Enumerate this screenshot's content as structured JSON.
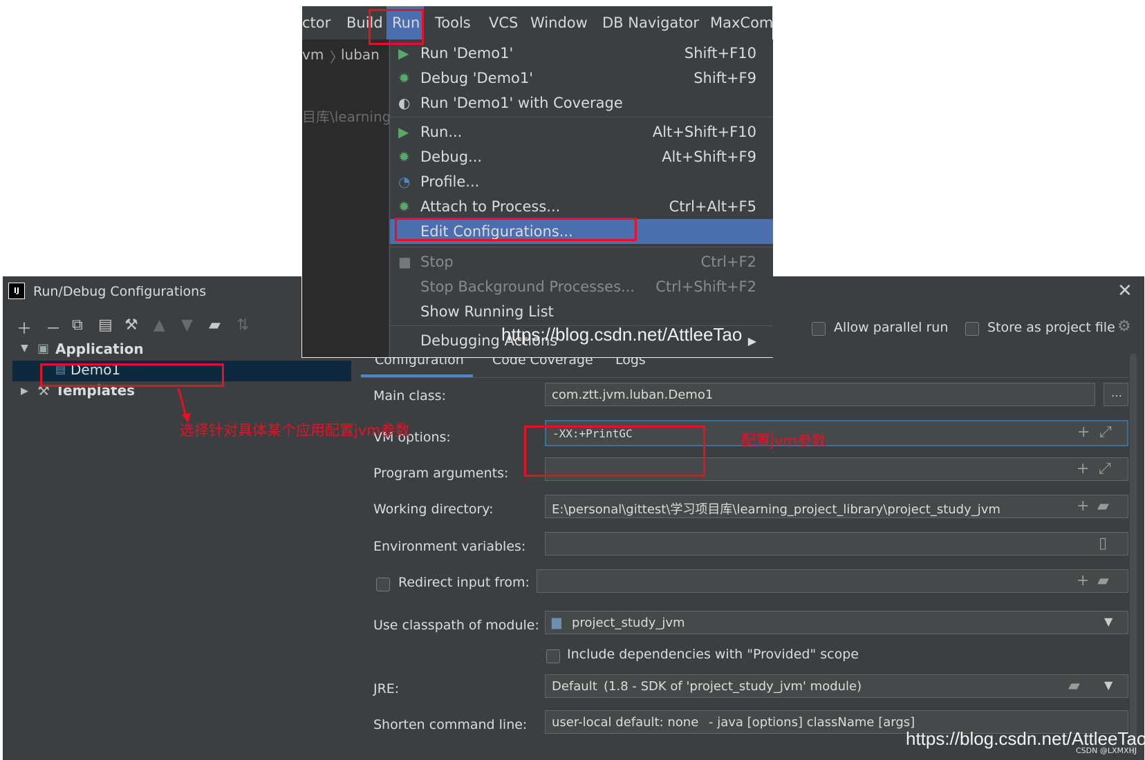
{
  "menubar": {
    "items": [
      "ctor",
      "Build",
      "Run",
      "Tools",
      "VCS",
      "Window",
      "DB Navigator",
      "MaxCom"
    ]
  },
  "editor_bg": {
    "breadcrumb_a": "vm",
    "breadcrumb_b": "luban",
    "path_fragment": "目库\\learning"
  },
  "run_menu": {
    "items": [
      {
        "label": "Run 'Demo1'",
        "shortcut": "Shift+F10",
        "icon": "play-icon"
      },
      {
        "label": "Debug 'Demo1'",
        "shortcut": "Shift+F9",
        "icon": "bug-icon"
      },
      {
        "label": "Run 'Demo1' with Coverage",
        "shortcut": "",
        "icon": "coverage-icon"
      },
      {
        "label": "Run...",
        "shortcut": "Alt+Shift+F10",
        "icon": "play-icon"
      },
      {
        "label": "Debug...",
        "shortcut": "Alt+Shift+F9",
        "icon": "bug-icon"
      },
      {
        "label": "Profile...",
        "shortcut": "",
        "icon": "gauge-icon"
      },
      {
        "label": "Attach to Process...",
        "shortcut": "Ctrl+Alt+F5",
        "icon": "attach-bug-icon"
      },
      {
        "label": "Edit Configurations...",
        "shortcut": "",
        "icon": ""
      },
      {
        "label": "Stop",
        "shortcut": "Ctrl+F2",
        "icon": "stop-icon"
      },
      {
        "label": "Stop Background Processes...",
        "shortcut": "Ctrl+Shift+F2",
        "icon": ""
      },
      {
        "label": "Show Running List",
        "shortcut": "",
        "icon": ""
      },
      {
        "label": "Debugging Actions",
        "shortcut": "",
        "icon": "submenu-arrow-icon"
      }
    ]
  },
  "dialog": {
    "title": "Run/Debug Configurations",
    "logo_text": "IJ",
    "close_glyph": "✕",
    "allow_parallel_run": "Allow parallel run",
    "store_as_project_file": "Store as project file",
    "tree": {
      "application": "Application",
      "demo1": "Demo1",
      "templates": "Templates"
    },
    "tabs": [
      "Configuration",
      "Code Coverage",
      "Logs"
    ],
    "fields": {
      "main_class_label": "Main class:",
      "main_class_value": "com.ztt.jvm.luban.Demo1",
      "vm_options_label": "VM options:",
      "vm_options_value": "-XX:+PrintGC",
      "program_arguments_label": "Program arguments:",
      "program_arguments_value": "",
      "working_directory_label": "Working directory:",
      "working_directory_value": "E:\\personal\\gittest\\学习项目库\\learning_project_library\\project_study_jvm",
      "environment_variables_label": "Environment variables:",
      "redirect_input_label": "Redirect input from:",
      "classpath_label": "Use classpath of module:",
      "classpath_value": "project_study_jvm",
      "include_dependencies_label": "Include dependencies with \"Provided\" scope",
      "jre_label": "JRE:",
      "jre_value": "Default",
      "jre_detail": "(1.8 - SDK of 'project_study_jvm' module)",
      "shorten_label": "Shorten command line:",
      "shorten_value": "user-local default: none",
      "shorten_detail": "- java [options] className [args]"
    }
  },
  "annotations": {
    "select_app_note": "选择针对具体某个应用配置jvm参数",
    "config_jvm_note": "配置jvm参数",
    "accent_color": "#e81123"
  },
  "watermarks": {
    "url": "https://blog.csdn.net/AttleeTao",
    "csdn": "CSDN @LXMXHJ"
  },
  "colors": {
    "selection_blue": "#4b6eaf",
    "panel_bg": "#3c3f41",
    "tree_selection": "#0d293e"
  }
}
